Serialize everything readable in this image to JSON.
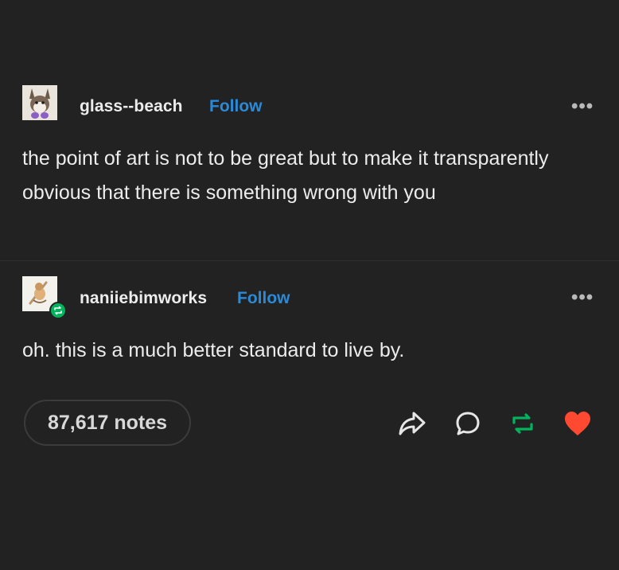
{
  "original_post": {
    "username": "glass--beach",
    "follow_label": "Follow",
    "more_label": "•••",
    "text": "the point of art is not to be great but to make it transparently obvious that there is something wrong with you"
  },
  "reblog": {
    "username": "naniiebimworks",
    "follow_label": "Follow",
    "more_label": "•••",
    "text": "oh. this is a much better standard to live by."
  },
  "footer": {
    "notes_label": "87,617 notes",
    "icons": [
      "share-icon",
      "reply-icon",
      "reblog-icon",
      "like-icon"
    ]
  },
  "colors": {
    "background": "#222222",
    "follow": "#2a8ad8",
    "reblog": "#00b35c",
    "like": "#ff4930"
  }
}
